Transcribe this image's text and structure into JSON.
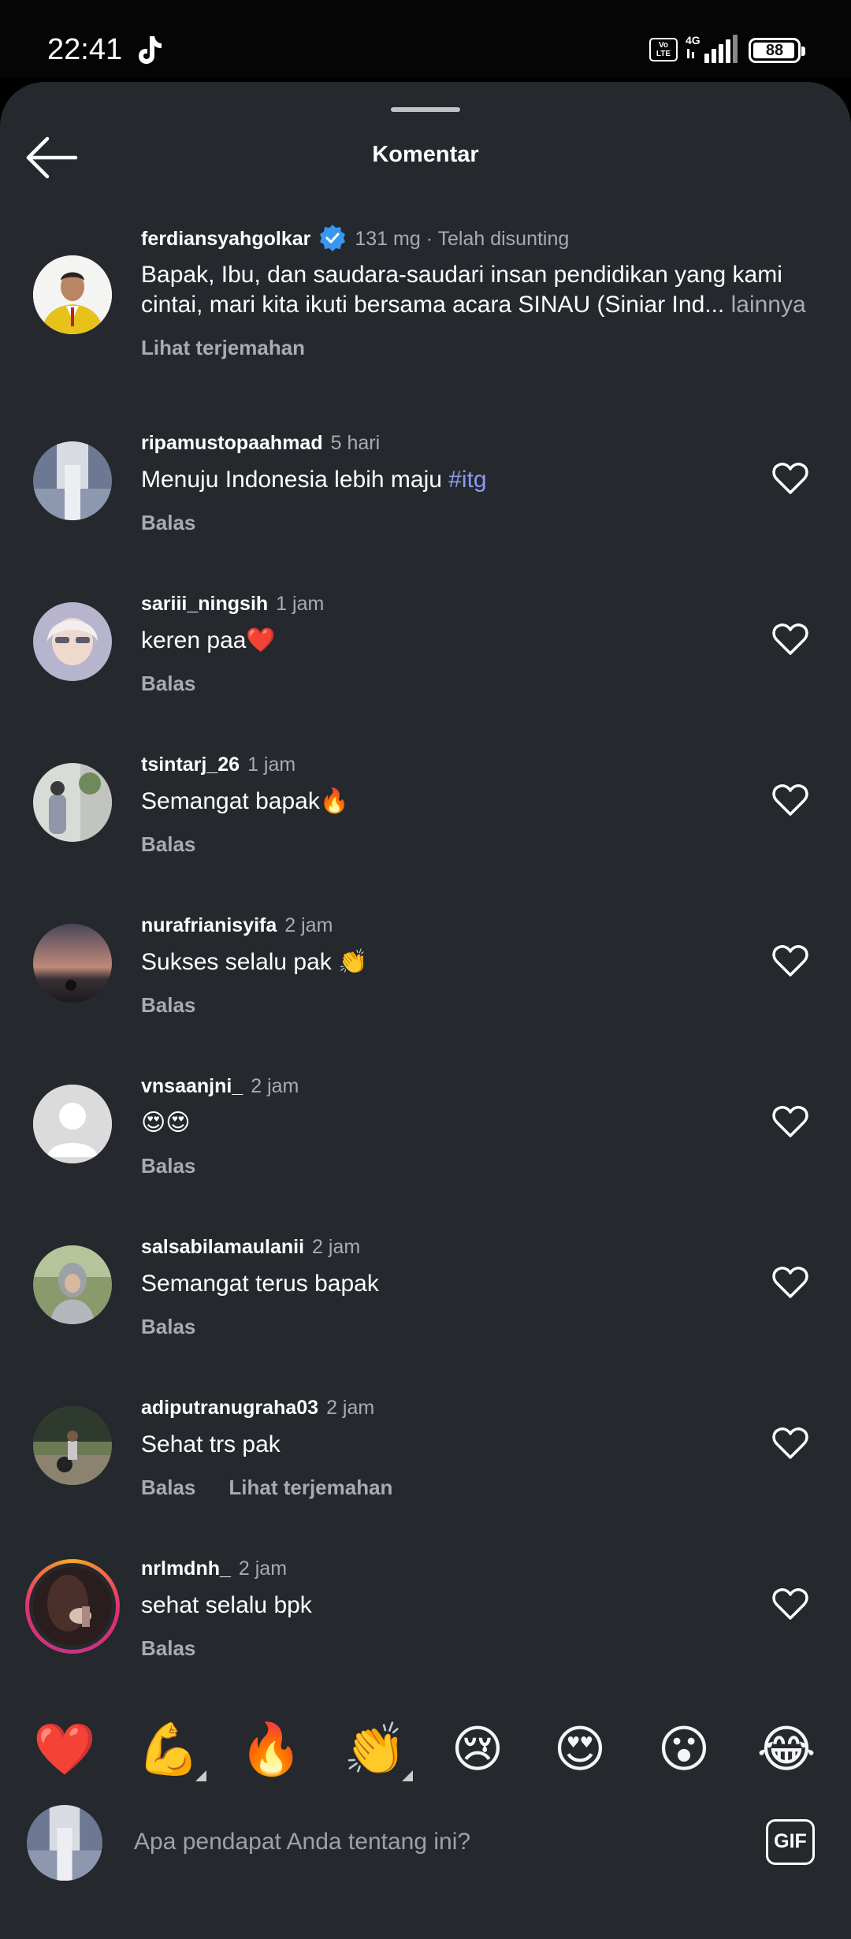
{
  "status_bar": {
    "time": "22:41",
    "volte": "Vo LTE",
    "network": "4G",
    "battery": "88"
  },
  "header": {
    "title": "Komentar"
  },
  "caption": {
    "username": "ferdiansyahgolkar",
    "meta": "131 mg · Telah disunting",
    "text": "Bapak, Ibu, dan saudara-saudari insan pendidikan yang kami cintai, mari kita ikuti bersama acara SINAU (Siniar Ind...",
    "more": " lainnya",
    "translate": "Lihat terjemahan"
  },
  "comments": [
    {
      "username": "ripamustopaahmad",
      "time": "5 hari",
      "text": "Menuju Indonesia lebih maju ",
      "hashtag": "#itg",
      "reply": "Balas"
    },
    {
      "username": "sariii_ningsih",
      "time": "1 jam",
      "text": "keren paa❤️",
      "reply": "Balas"
    },
    {
      "username": "tsintarj_26",
      "time": "1 jam",
      "text": "Semangat bapak🔥",
      "reply": "Balas"
    },
    {
      "username": "nurafrianisyifa",
      "time": "2 jam",
      "text": "Sukses selalu pak 👏",
      "reply": "Balas"
    },
    {
      "username": "vnsaanjni_",
      "time": "2 jam",
      "text": "😍😍",
      "reply": "Balas"
    },
    {
      "username": "salsabilamaulanii",
      "time": "2 jam",
      "text": "Semangat terus bapak",
      "reply": "Balas"
    },
    {
      "username": "adiputranugraha03",
      "time": "2 jam",
      "text": "Sehat trs pak",
      "reply": "Balas",
      "translate": "Lihat terjemahan"
    },
    {
      "username": "nrlmdnh_",
      "time": "2 jam",
      "text": "sehat selalu bpk",
      "reply": "Balas"
    }
  ],
  "reactions": [
    "❤️",
    "💪",
    "🔥",
    "👏",
    "😢",
    "😍",
    "😮",
    "😂"
  ],
  "composer": {
    "placeholder": "Apa pendapat Anda tentang ini?",
    "gif_label": "GIF"
  },
  "colors": {
    "sheet_background": "#25282d",
    "hashtag": "#8c9af2",
    "secondary_text": "#a8acb2",
    "verified_blue": "#3897f0",
    "story_ring": "#e1306c"
  }
}
